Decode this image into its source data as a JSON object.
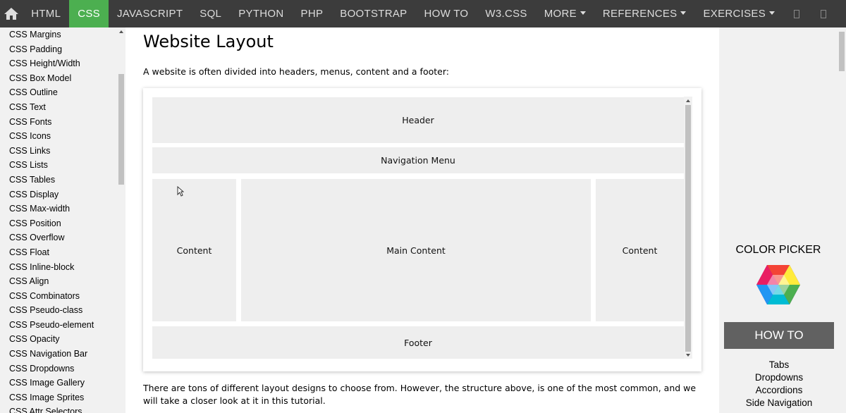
{
  "topnav": {
    "items": [
      {
        "label": "HTML"
      },
      {
        "label": "CSS",
        "active": true
      },
      {
        "label": "JAVASCRIPT"
      },
      {
        "label": "SQL"
      },
      {
        "label": "PYTHON"
      },
      {
        "label": "PHP"
      },
      {
        "label": "BOOTSTRAP"
      },
      {
        "label": "HOW TO"
      },
      {
        "label": "W3.CSS"
      }
    ],
    "more_label": "MORE",
    "references_label": "REFERENCES",
    "exercises_label": "EXERCISES",
    "active_color": "#4caf50",
    "bar_color": "#3c3c3c"
  },
  "sidebar": {
    "items": [
      "CSS Margins",
      "CSS Padding",
      "CSS Height/Width",
      "CSS Box Model",
      "CSS Outline",
      "CSS Text",
      "CSS Fonts",
      "CSS Icons",
      "CSS Links",
      "CSS Lists",
      "CSS Tables",
      "CSS Display",
      "CSS Max-width",
      "CSS Position",
      "CSS Overflow",
      "CSS Float",
      "CSS Inline-block",
      "CSS Align",
      "CSS Combinators",
      "CSS Pseudo-class",
      "CSS Pseudo-element",
      "CSS Opacity",
      "CSS Navigation Bar",
      "CSS Dropdowns",
      "CSS Image Gallery",
      "CSS Image Sprites",
      "CSS Attr Selectors"
    ]
  },
  "main": {
    "title": "Website Layout",
    "intro": "A website is often divided into headers, menus, content and a footer:",
    "demo": {
      "header": "Header",
      "nav": "Navigation Menu",
      "left": "Content",
      "center": "Main Content",
      "right": "Content",
      "footer": "Footer"
    },
    "paragraph": "There are tons of different layout designs to choose from. However, the structure above, is one of the most common, and we will take a closer look at it in this tutorial."
  },
  "rightbar": {
    "color_picker_label": "COLOR PICKER",
    "howto_title": "HOW TO",
    "howto_links": [
      "Tabs",
      "Dropdowns",
      "Accordions",
      "Side Navigation"
    ]
  }
}
